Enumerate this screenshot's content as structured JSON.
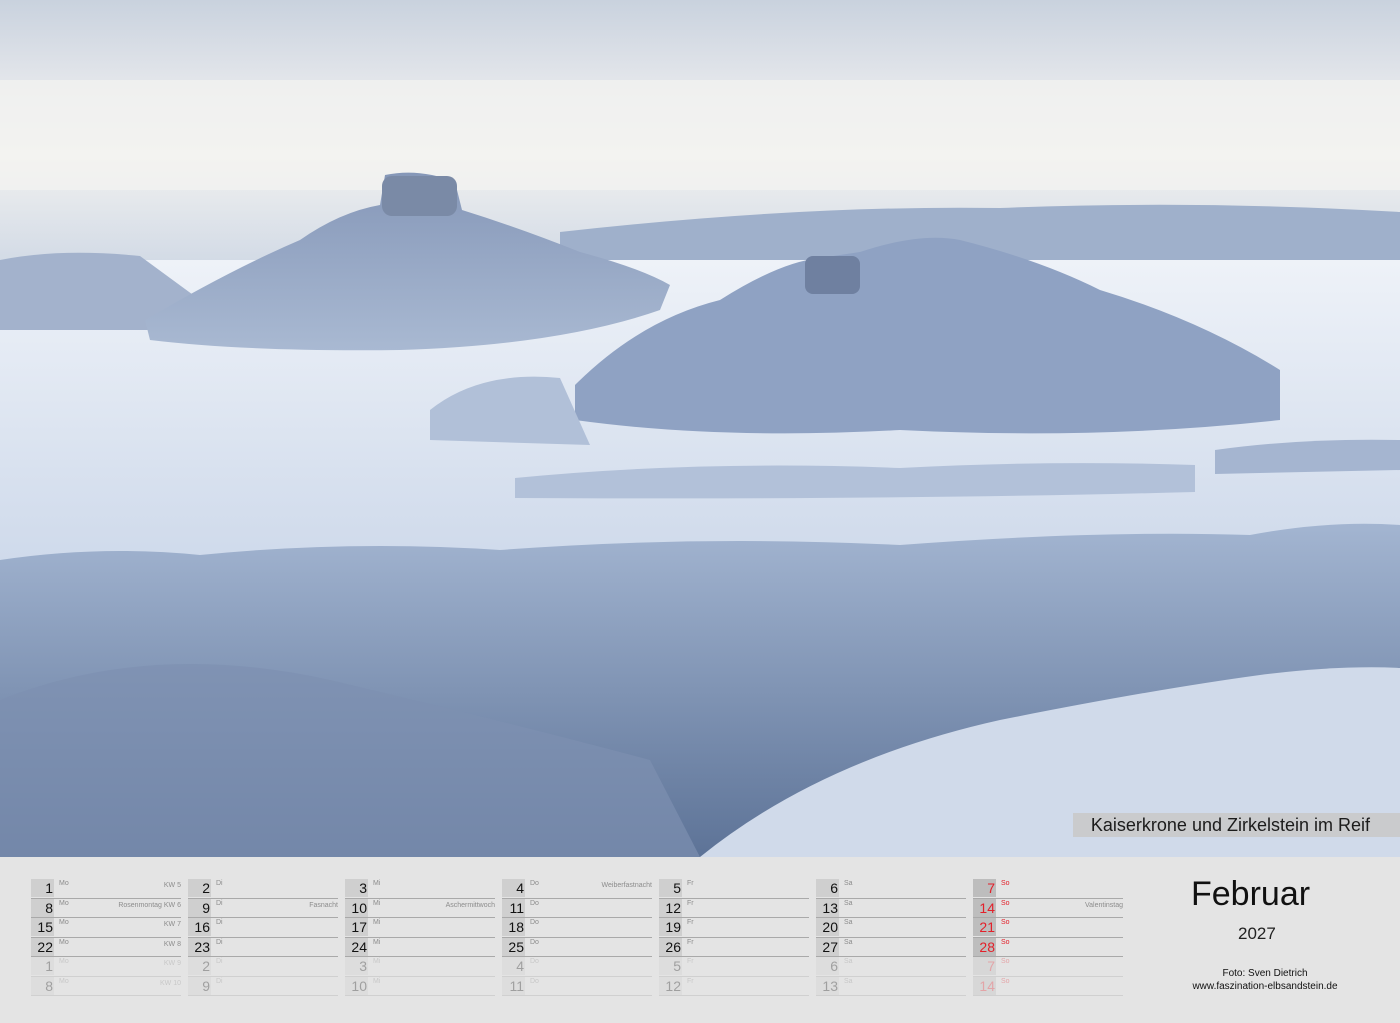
{
  "photo": {
    "caption": "Kaiserkrone und Zirkelstein im Reif"
  },
  "month": "Februar",
  "year": "2027",
  "credit": {
    "line1": "Foto: Sven Dietrich",
    "line2": "www.faszination-elbsandstein.de"
  },
  "colors": {
    "sunday_red": "#e3202a",
    "day_box": "#cfcfcf",
    "background": "#e4e4e4"
  },
  "columns": [
    [
      {
        "day": "1",
        "weekday": "Mo",
        "note": "KW 5"
      },
      {
        "day": "8",
        "weekday": "Mo",
        "note": "Rosenmontag KW 6"
      },
      {
        "day": "15",
        "weekday": "Mo",
        "note": "KW 7"
      },
      {
        "day": "22",
        "weekday": "Mo",
        "note": "KW 8"
      },
      {
        "day": "1",
        "weekday": "Mo",
        "note": "KW 9",
        "faded": true
      },
      {
        "day": "8",
        "weekday": "Mo",
        "note": "KW 10",
        "faded": true
      }
    ],
    [
      {
        "day": "2",
        "weekday": "Di",
        "note": ""
      },
      {
        "day": "9",
        "weekday": "Di",
        "note": "Fasnacht"
      },
      {
        "day": "16",
        "weekday": "Di",
        "note": ""
      },
      {
        "day": "23",
        "weekday": "Di",
        "note": ""
      },
      {
        "day": "2",
        "weekday": "Di",
        "note": "",
        "faded": true
      },
      {
        "day": "9",
        "weekday": "Di",
        "note": "",
        "faded": true
      }
    ],
    [
      {
        "day": "3",
        "weekday": "Mi",
        "note": ""
      },
      {
        "day": "10",
        "weekday": "Mi",
        "note": "Aschermittwoch"
      },
      {
        "day": "17",
        "weekday": "Mi",
        "note": ""
      },
      {
        "day": "24",
        "weekday": "Mi",
        "note": ""
      },
      {
        "day": "3",
        "weekday": "Mi",
        "note": "",
        "faded": true
      },
      {
        "day": "10",
        "weekday": "Mi",
        "note": "",
        "faded": true
      }
    ],
    [
      {
        "day": "4",
        "weekday": "Do",
        "note": "Weiberfastnacht"
      },
      {
        "day": "11",
        "weekday": "Do",
        "note": ""
      },
      {
        "day": "18",
        "weekday": "Do",
        "note": ""
      },
      {
        "day": "25",
        "weekday": "Do",
        "note": ""
      },
      {
        "day": "4",
        "weekday": "Do",
        "note": "",
        "faded": true
      },
      {
        "day": "11",
        "weekday": "Do",
        "note": "",
        "faded": true
      }
    ],
    [
      {
        "day": "5",
        "weekday": "Fr",
        "note": ""
      },
      {
        "day": "12",
        "weekday": "Fr",
        "note": ""
      },
      {
        "day": "19",
        "weekday": "Fr",
        "note": ""
      },
      {
        "day": "26",
        "weekday": "Fr",
        "note": ""
      },
      {
        "day": "5",
        "weekday": "Fr",
        "note": "",
        "faded": true
      },
      {
        "day": "12",
        "weekday": "Fr",
        "note": "",
        "faded": true
      }
    ],
    [
      {
        "day": "6",
        "weekday": "Sa",
        "note": ""
      },
      {
        "day": "13",
        "weekday": "Sa",
        "note": ""
      },
      {
        "day": "20",
        "weekday": "Sa",
        "note": ""
      },
      {
        "day": "27",
        "weekday": "Sa",
        "note": ""
      },
      {
        "day": "6",
        "weekday": "Sa",
        "note": "",
        "faded": true
      },
      {
        "day": "13",
        "weekday": "Sa",
        "note": "",
        "faded": true
      }
    ],
    [
      {
        "day": "7",
        "weekday": "So",
        "note": "",
        "sunday": true
      },
      {
        "day": "14",
        "weekday": "So",
        "note": "Valentinstag",
        "sunday": true
      },
      {
        "day": "21",
        "weekday": "So",
        "note": "",
        "sunday": true
      },
      {
        "day": "28",
        "weekday": "So",
        "note": "",
        "sunday": true
      },
      {
        "day": "7",
        "weekday": "So",
        "note": "",
        "sunday": true,
        "faded": true
      },
      {
        "day": "14",
        "weekday": "So",
        "note": "",
        "sunday": true,
        "faded": true
      }
    ]
  ]
}
